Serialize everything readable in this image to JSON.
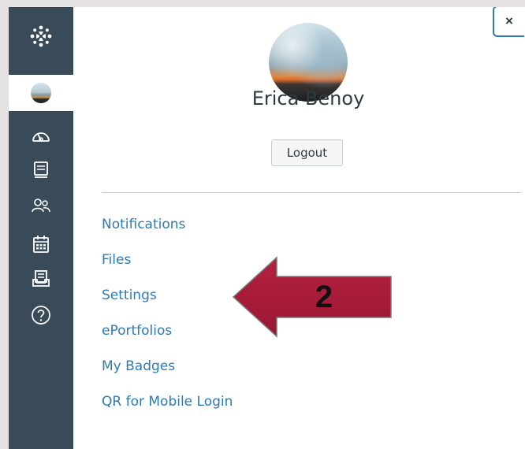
{
  "user": {
    "name": "Erica Benoy"
  },
  "tray": {
    "logout_label": "Logout",
    "close_label": "×",
    "links": [
      {
        "label": "Notifications"
      },
      {
        "label": "Files"
      },
      {
        "label": "Settings"
      },
      {
        "label": "ePortfolios"
      },
      {
        "label": "My Badges"
      },
      {
        "label": "QR for Mobile Login"
      }
    ]
  },
  "global_nav": {
    "items": [
      {
        "icon": "canvas-logo-icon"
      },
      {
        "icon": "account-avatar-icon",
        "active": true
      },
      {
        "icon": "dashboard-icon"
      },
      {
        "icon": "courses-icon"
      },
      {
        "icon": "groups-icon"
      },
      {
        "icon": "calendar-icon"
      },
      {
        "icon": "inbox-icon"
      },
      {
        "icon": "help-icon"
      }
    ]
  },
  "annotation": {
    "arrow_number": "2",
    "arrow_color": "#a31c37"
  },
  "colors": {
    "nav_bg": "#394b58",
    "link": "#2d7bb6",
    "text": "#2d3b45"
  }
}
